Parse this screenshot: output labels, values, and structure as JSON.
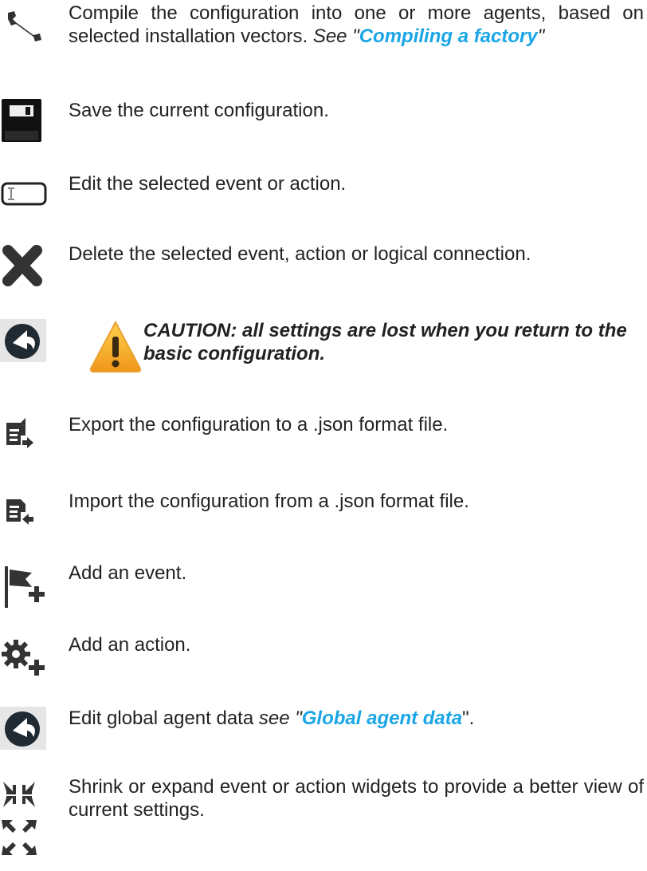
{
  "rows": {
    "compile": {
      "text_a": "Compile the configuration into one or more agents, based on selected installation vectors.",
      "see": " See \"",
      "link": "Compiling a factory",
      "close": "\""
    },
    "save": {
      "text": "Save the current configuration."
    },
    "edit": {
      "text": "Edit the selected event or action."
    },
    "delete": {
      "text": "Delete the selected event, action or logical connection."
    },
    "reset": {
      "caution": "CAUTION: all settings are lost when you return to the basic configuration."
    },
    "export": {
      "text": "Export the configuration to a .json format file."
    },
    "import": {
      "text": "Import the configuration from a .json format file."
    },
    "add_event": {
      "text": "Add an event."
    },
    "add_action": {
      "text": "Add an action."
    },
    "global": {
      "prefix": "Edit global agent data ",
      "see": "see",
      "open": " \"",
      "link": "Global agent data",
      "close": "\"."
    },
    "shrink": {
      "text": "Shrink or expand event or action widgets to provide a better view of current settings."
    }
  },
  "colors": {
    "link": "#1aa6e6",
    "text": "#222222",
    "warning": "#f5a623"
  }
}
